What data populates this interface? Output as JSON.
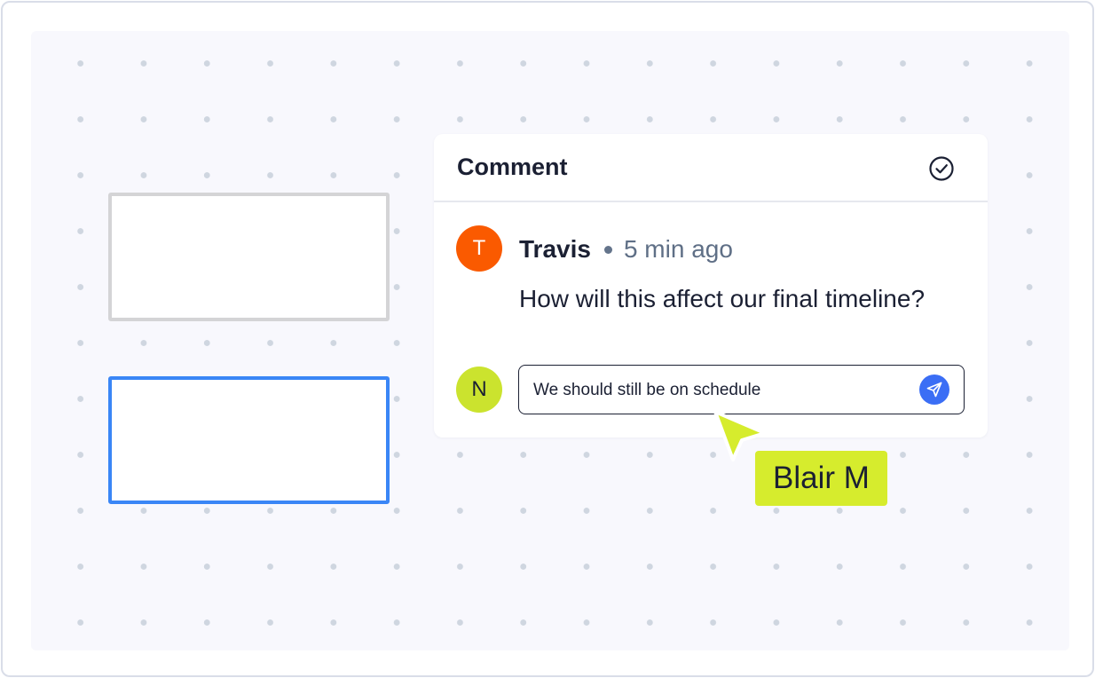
{
  "comment_panel": {
    "title": "Comment",
    "resolve_icon": "check-circle-icon",
    "comment": {
      "avatar_initial": "T",
      "avatar_color": "#fa5a00",
      "author": "Travis",
      "time_ago": "5 min ago",
      "text": "How will this affect our final timeline?"
    },
    "reply": {
      "avatar_initial": "N",
      "avatar_color": "#cbe32e",
      "input_value": "We should still be on schedule",
      "send_icon": "send-icon"
    }
  },
  "canvas": {
    "shapes": [
      {
        "name": "rectangle",
        "border_color": "#d4d4d6"
      },
      {
        "name": "rectangle-selected",
        "border_color": "#3a86f6"
      }
    ]
  },
  "collaborator_cursor": {
    "label": "Blair M",
    "color": "#d6ec2d"
  }
}
